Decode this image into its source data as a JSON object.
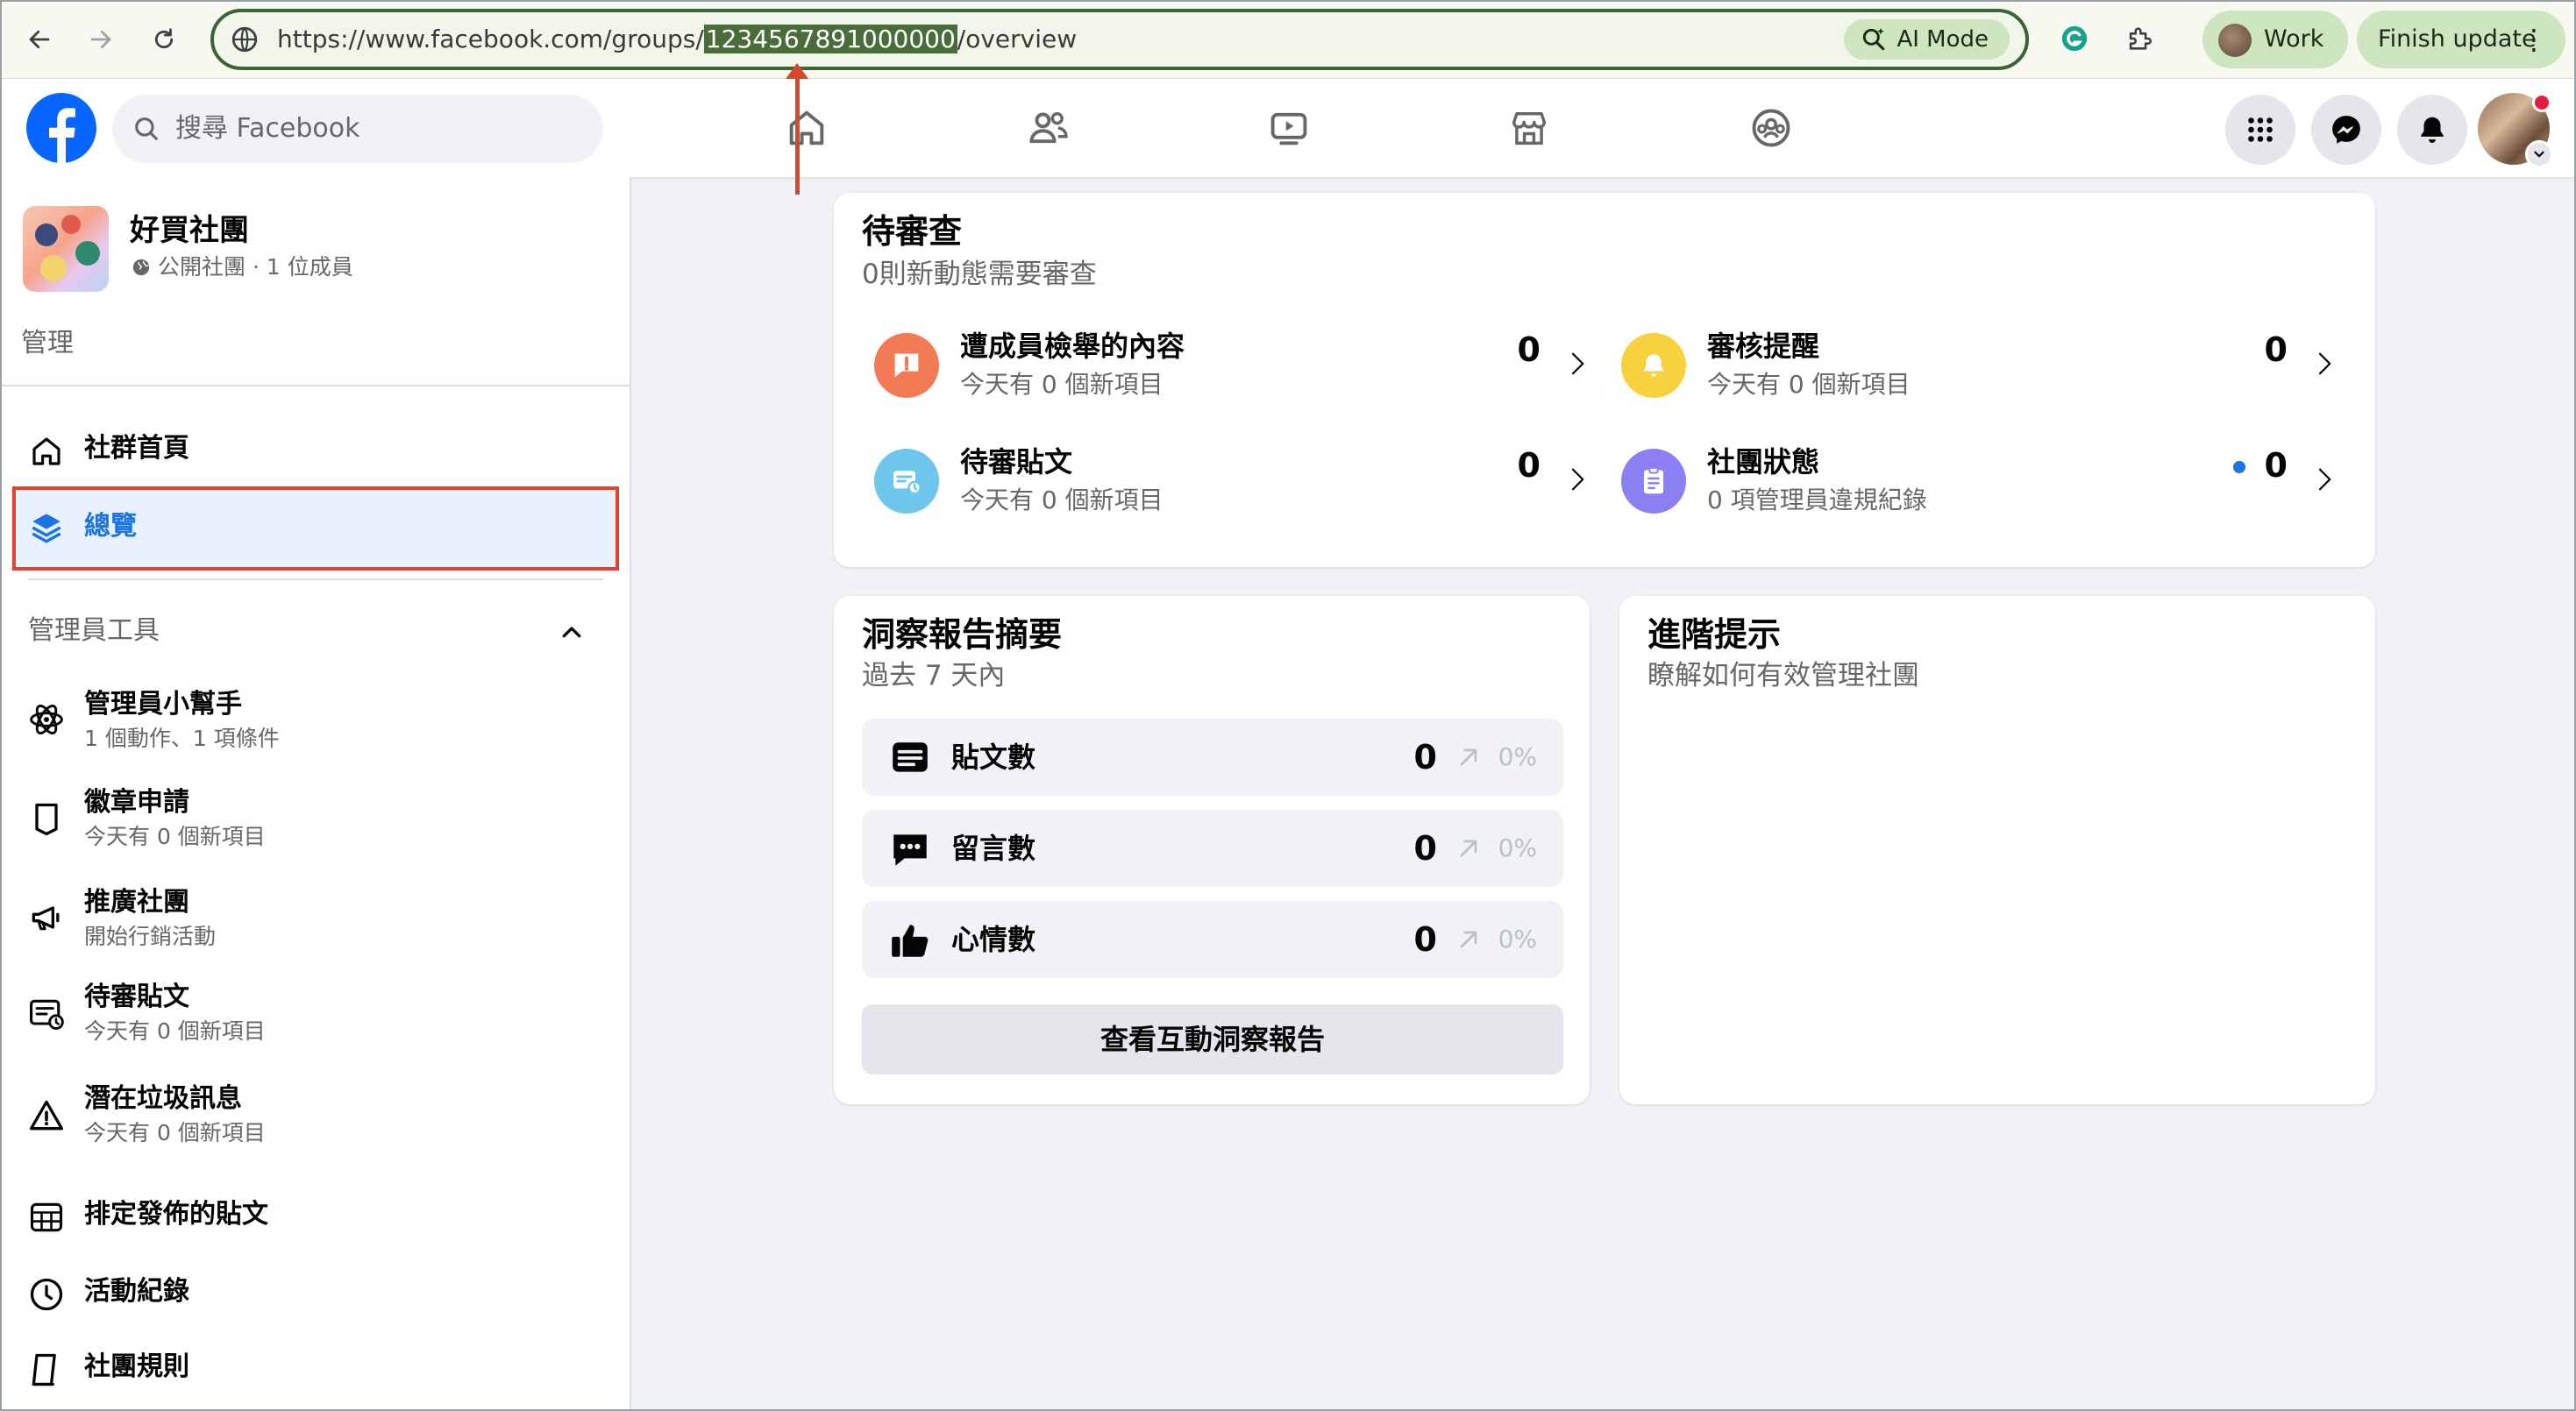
{
  "browser": {
    "url_prefix": "https://www.facebook.com/groups/",
    "url_highlight": "1234567891000000",
    "url_suffix": "/overview",
    "ai_mode_label": "AI Mode",
    "profile_label": "Work",
    "finish_update_label": "Finish update",
    "menu_glyph": "⋮"
  },
  "fb": {
    "search_placeholder": "搜尋 Facebook",
    "brand_color": "#0866ff"
  },
  "group": {
    "name": "好買社團",
    "meta": "公開社團 · 1 位成員"
  },
  "sidebar": {
    "manage_heading": "管理",
    "admin_tools_heading": "管理員工具",
    "top_items": [
      {
        "label": "社群首頁",
        "icon": "home-icon"
      },
      {
        "label": "總覽",
        "icon": "layers-icon",
        "active": true
      }
    ],
    "tools": [
      {
        "label": "管理員小幫手",
        "sub": "1 個動作、1 項條件",
        "icon": "assistant-icon"
      },
      {
        "label": "徽章申請",
        "sub": "今天有 0 個新項目",
        "icon": "badge-icon"
      },
      {
        "label": "推廣社團",
        "sub": "開始行銷活動",
        "icon": "megaphone-icon"
      },
      {
        "label": "待審貼文",
        "sub": "今天有 0 個新項目",
        "icon": "pending-post-icon"
      },
      {
        "label": "潛在垃圾訊息",
        "sub": "今天有 0 個新項目",
        "icon": "warning-icon"
      },
      {
        "label": "排定發佈的貼文",
        "sub": "",
        "icon": "calendar-icon"
      },
      {
        "label": "活動紀錄",
        "sub": "",
        "icon": "clock-icon"
      },
      {
        "label": "社團規則",
        "sub": "",
        "icon": "book-icon"
      }
    ]
  },
  "pending": {
    "title": "待審查",
    "subtitle": "0則新動態需要審查",
    "items": [
      {
        "title": "遭成員檢舉的內容",
        "sub": "今天有 0 個新項目",
        "count": "0",
        "color": "#f27a54"
      },
      {
        "title": "審核提醒",
        "sub": "今天有 0 個新項目",
        "count": "0",
        "color": "#f7d23e"
      },
      {
        "title": "待審貼文",
        "sub": "今天有 0 個新項目",
        "count": "0",
        "color": "#6fc6ec"
      },
      {
        "title": "社團狀態",
        "sub": "0 項管理員違規紀錄",
        "count": "0",
        "color": "#8b7ff4"
      }
    ]
  },
  "insights": {
    "title": "洞察報告摘要",
    "subtitle": "過去 7 天內",
    "rows": [
      {
        "label": "貼文數",
        "value": "0",
        "pct": "0%",
        "icon": "post-icon"
      },
      {
        "label": "留言數",
        "value": "0",
        "pct": "0%",
        "icon": "comment-icon"
      },
      {
        "label": "心情數",
        "value": "0",
        "pct": "0%",
        "icon": "thumbs-up-icon"
      }
    ],
    "button_label": "查看互動洞察報告"
  },
  "tips": {
    "title": "進階提示",
    "subtitle": "瞭解如何有效管理社團"
  }
}
